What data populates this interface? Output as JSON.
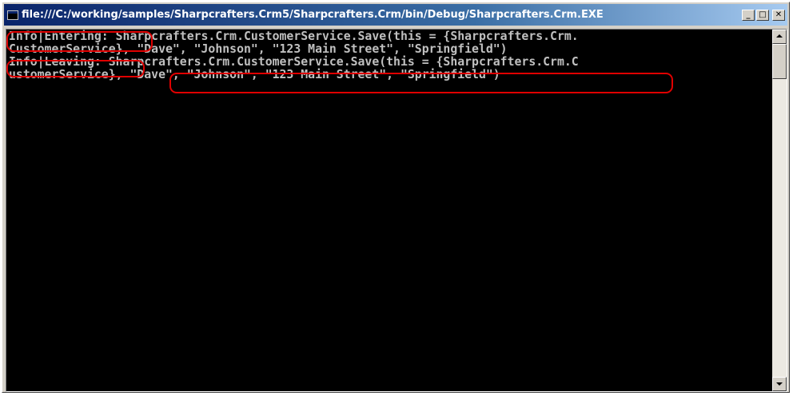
{
  "window": {
    "title": "file:///C:/working/samples/Sharpcrafters.Crm5/Sharpcrafters.Crm/bin/Debug/Sharpcrafters.Crm.EXE",
    "minimize_label": "_",
    "maximize_label": "□",
    "close_label": "✕"
  },
  "console": {
    "lines": [
      "Info|Entering: Sharpcrafters.Crm.CustomerService.Save(this = {Sharpcrafters.Crm.",
      "CustomerService}, \"Dave\", \"Johnson\", \"123 Main Street\", \"Springfield\")",
      "Info|Leaving: Sharpcrafters.Crm.CustomerService.Save(this = {Sharpcrafters.Crm.C",
      "ustomerService}, \"Dave\", \"Johnson\", \"123 Main Street\", \"Springfield\")"
    ]
  },
  "colors": {
    "console_background": "#000000",
    "console_text": "#c0c0c0",
    "highlight": "#e00000",
    "titlebar_start": "#0a246a",
    "titlebar_end": "#a6caf0"
  }
}
